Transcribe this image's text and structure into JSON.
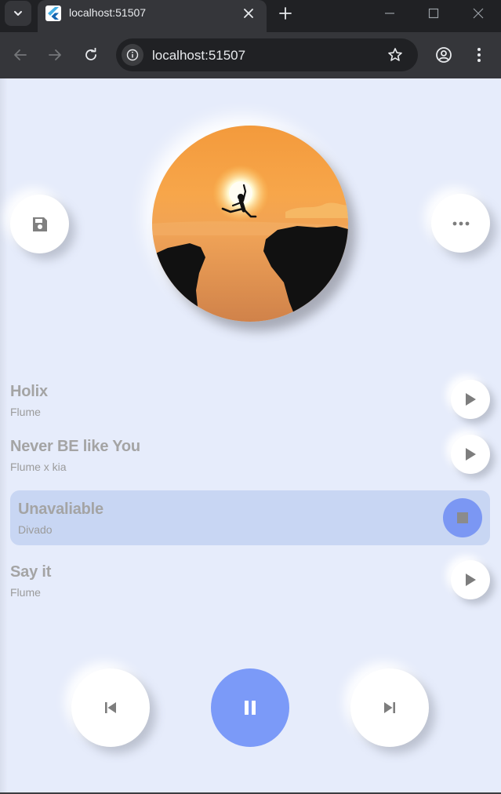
{
  "browser": {
    "tab_title": "localhost:51507",
    "url": "localhost:51507"
  },
  "colors": {
    "background": "#e6ecfb",
    "accent": "#7b9af8",
    "active_row": "#c8d6f3",
    "text_muted": "#a4a4a4"
  },
  "player": {
    "left_action_icon": "save-icon",
    "right_action_icon": "more-horizontal-icon",
    "album_art": "silhouette-jumping-between-cliffs-at-sunset"
  },
  "tracks": [
    {
      "title": "Holix",
      "artist": "Flume",
      "state": "play"
    },
    {
      "title": "Never BE like You",
      "artist": "Flume x kia",
      "state": "play"
    },
    {
      "title": "Unavaliable",
      "artist": "Divado",
      "state": "stop"
    },
    {
      "title": "Say it",
      "artist": "Flume",
      "state": "play"
    }
  ],
  "controls": {
    "previous_icon": "skip-previous-icon",
    "main_icon": "pause-icon",
    "next_icon": "skip-next-icon"
  }
}
